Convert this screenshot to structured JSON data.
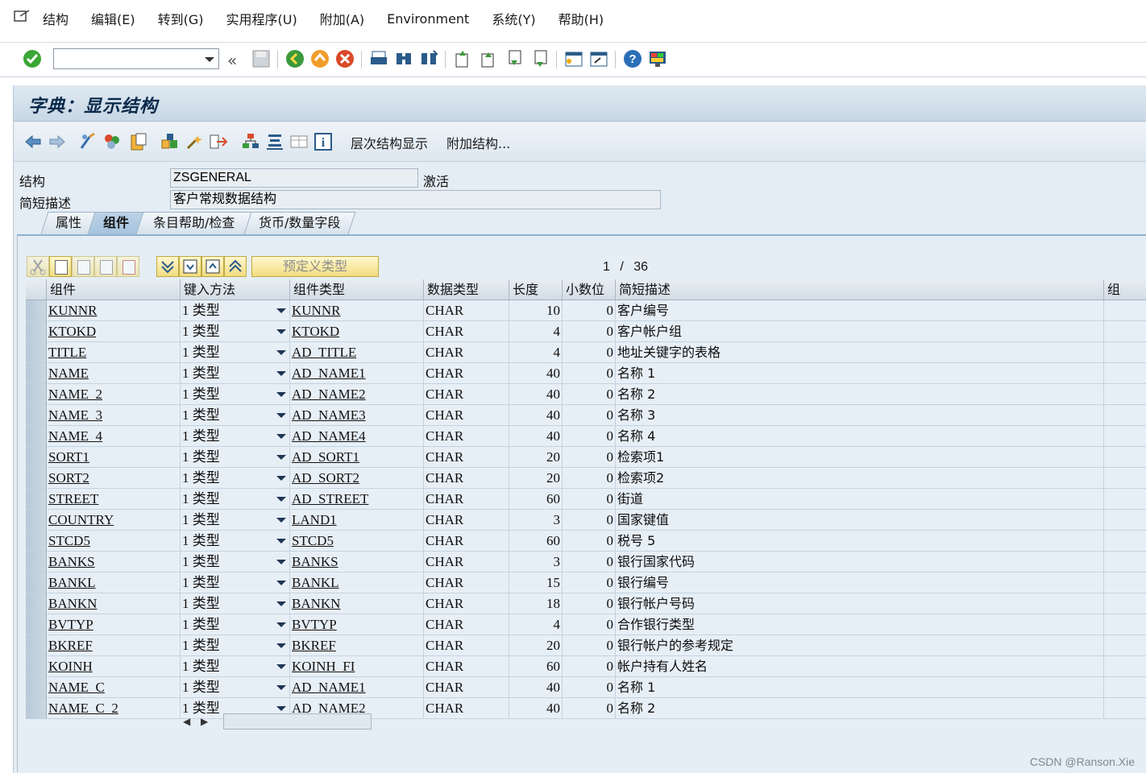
{
  "menubar": {
    "items": [
      "结构",
      "编辑(E)",
      "转到(G)",
      "实用程序(U)",
      "附加(A)",
      "Environment",
      "系统(Y)",
      "帮助(H)"
    ]
  },
  "systoolbar": {
    "command_field_value": "",
    "icons": [
      "enter-icon",
      "save-icon",
      "back-icon",
      "exit-icon",
      "cancel-icon",
      "print-icon",
      "find-icon",
      "find-next-icon",
      "first-page-icon",
      "prev-page-icon",
      "next-page-icon",
      "last-page-icon",
      "new-session-icon",
      "shortcut-icon",
      "help-icon",
      "layout-icon"
    ]
  },
  "window": {
    "title": "字典：显示结构"
  },
  "apptoolbar": {
    "hierarchy_label": "层次结构显示",
    "append_label": "附加结构..."
  },
  "header": {
    "structure_label": "结构",
    "structure_value": "ZSGENERAL",
    "status": "激活",
    "desc_label": "简短描述",
    "desc_value": "客户常规数据结构"
  },
  "tabs": [
    "属性",
    "组件",
    "条目帮助/检查",
    "货币/数量字段"
  ],
  "active_tab": "组件",
  "table_toolbar": {
    "predefined_type_label": "预定义类型",
    "page_current": "1",
    "page_sep": "/",
    "page_total": "36"
  },
  "grid": {
    "columns": [
      "组件",
      "键入方法",
      "组件类型",
      "数据类型",
      "长度",
      "小数位",
      "简短描述",
      "组"
    ],
    "rows": [
      {
        "comp": "KUNNR",
        "method": "1 类型",
        "ctype": "KUNNR",
        "dtype": "CHAR",
        "len": "10",
        "dec": "0",
        "desc": "客户编号"
      },
      {
        "comp": "KTOKD",
        "method": "1 类型",
        "ctype": "KTOKD",
        "dtype": "CHAR",
        "len": "4",
        "dec": "0",
        "desc": "客户帐户组"
      },
      {
        "comp": "TITLE",
        "method": "1 类型",
        "ctype": "AD_TITLE",
        "dtype": "CHAR",
        "len": "4",
        "dec": "0",
        "desc": "地址关键字的表格"
      },
      {
        "comp": "NAME",
        "method": "1 类型",
        "ctype": "AD_NAME1",
        "dtype": "CHAR",
        "len": "40",
        "dec": "0",
        "desc": "名称 1"
      },
      {
        "comp": "NAME_2",
        "method": "1 类型",
        "ctype": "AD_NAME2",
        "dtype": "CHAR",
        "len": "40",
        "dec": "0",
        "desc": "名称 2"
      },
      {
        "comp": "NAME_3",
        "method": "1 类型",
        "ctype": "AD_NAME3",
        "dtype": "CHAR",
        "len": "40",
        "dec": "0",
        "desc": "名称 3"
      },
      {
        "comp": "NAME_4",
        "method": "1 类型",
        "ctype": "AD_NAME4",
        "dtype": "CHAR",
        "len": "40",
        "dec": "0",
        "desc": "名称 4"
      },
      {
        "comp": "SORT1",
        "method": "1 类型",
        "ctype": "AD_SORT1",
        "dtype": "CHAR",
        "len": "20",
        "dec": "0",
        "desc": "检索项1"
      },
      {
        "comp": "SORT2",
        "method": "1 类型",
        "ctype": "AD_SORT2",
        "dtype": "CHAR",
        "len": "20",
        "dec": "0",
        "desc": "检索项2"
      },
      {
        "comp": "STREET",
        "method": "1 类型",
        "ctype": "AD_STREET",
        "dtype": "CHAR",
        "len": "60",
        "dec": "0",
        "desc": "街道"
      },
      {
        "comp": "COUNTRY",
        "method": "1 类型",
        "ctype": "LAND1",
        "dtype": "CHAR",
        "len": "3",
        "dec": "0",
        "desc": "国家键值"
      },
      {
        "comp": "STCD5",
        "method": "1 类型",
        "ctype": "STCD5",
        "dtype": "CHAR",
        "len": "60",
        "dec": "0",
        "desc": "税号 5"
      },
      {
        "comp": "BANKS",
        "method": "1 类型",
        "ctype": "BANKS",
        "dtype": "CHAR",
        "len": "3",
        "dec": "0",
        "desc": "银行国家代码"
      },
      {
        "comp": "BANKL",
        "method": "1 类型",
        "ctype": "BANKL",
        "dtype": "CHAR",
        "len": "15",
        "dec": "0",
        "desc": "银行编号"
      },
      {
        "comp": "BANKN",
        "method": "1 类型",
        "ctype": "BANKN",
        "dtype": "CHAR",
        "len": "18",
        "dec": "0",
        "desc": "银行帐户号码"
      },
      {
        "comp": "BVTYP",
        "method": "1 类型",
        "ctype": "BVTYP",
        "dtype": "CHAR",
        "len": "4",
        "dec": "0",
        "desc": "合作银行类型"
      },
      {
        "comp": "BKREF",
        "method": "1 类型",
        "ctype": "BKREF",
        "dtype": "CHAR",
        "len": "20",
        "dec": "0",
        "desc": "银行帐户的参考规定"
      },
      {
        "comp": "KOINH",
        "method": "1 类型",
        "ctype": "KOINH_FI",
        "dtype": "CHAR",
        "len": "60",
        "dec": "0",
        "desc": "帐户持有人姓名"
      },
      {
        "comp": "NAME_C",
        "method": "1 类型",
        "ctype": "AD_NAME1",
        "dtype": "CHAR",
        "len": "40",
        "dec": "0",
        "desc": "名称 1"
      },
      {
        "comp": "NAME_C_2",
        "method": "1 类型",
        "ctype": "AD_NAME2",
        "dtype": "CHAR",
        "len": "40",
        "dec": "0",
        "desc": "名称 2"
      }
    ]
  },
  "watermark": "CSDN @Ranson.Xie"
}
